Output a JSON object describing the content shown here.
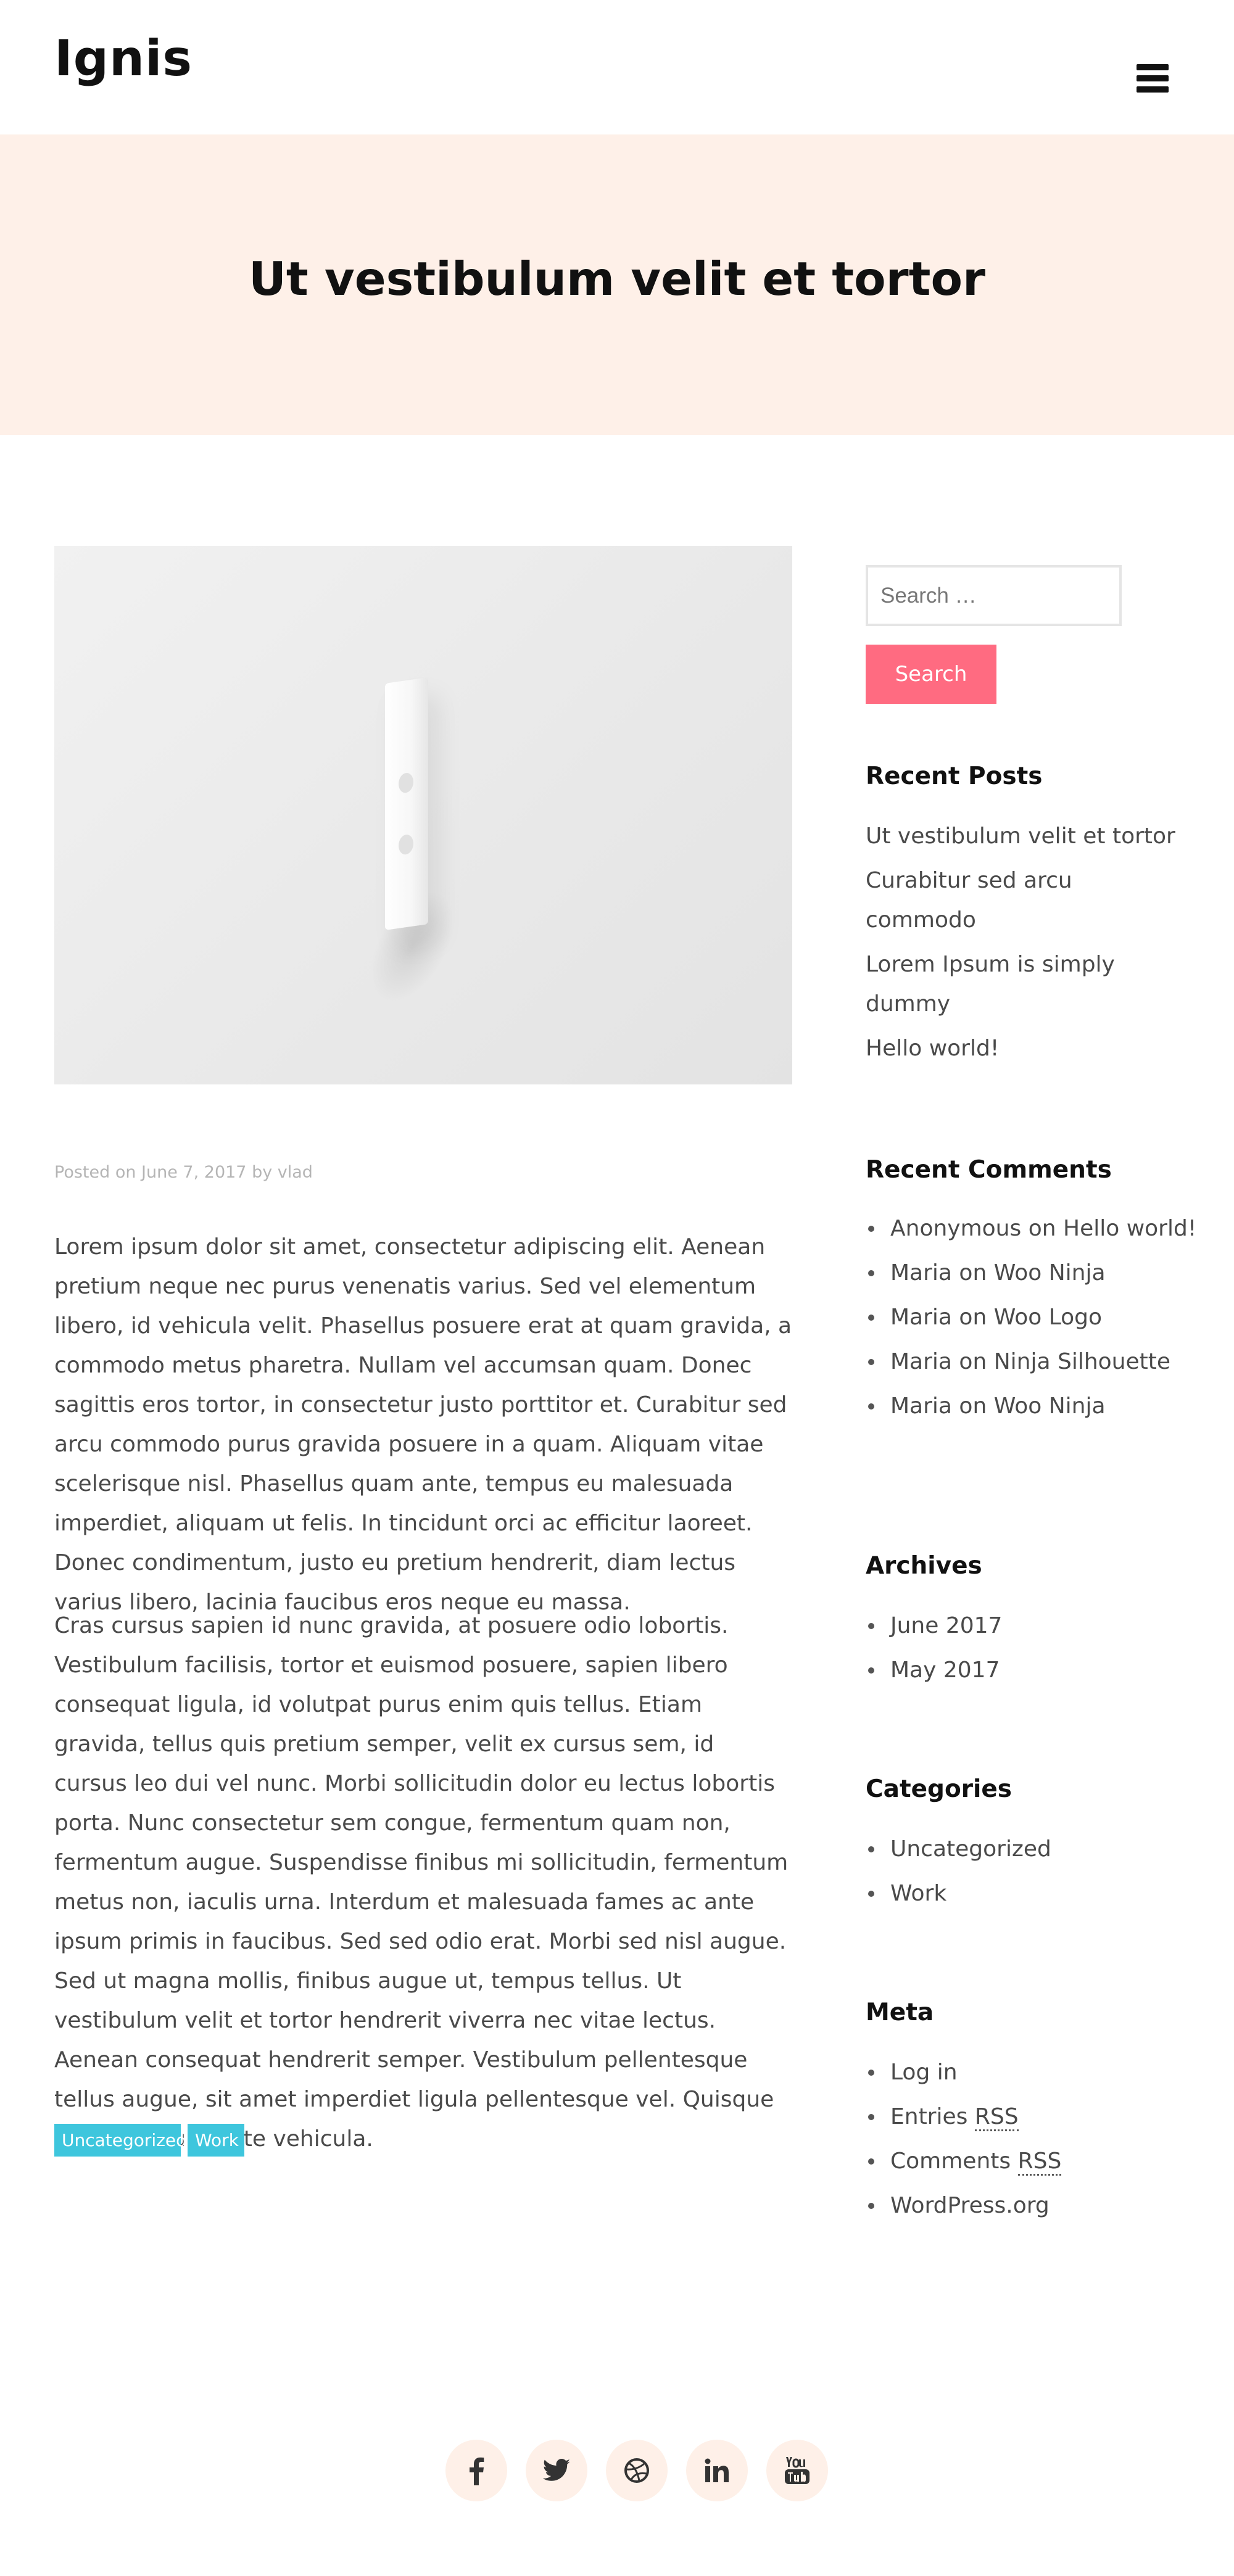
{
  "header": {
    "site_title": "Ignis",
    "menu_icon": "hamburger-menu-icon"
  },
  "hero": {
    "title": "Ut vestibulum velit et tortor"
  },
  "post": {
    "meta_prefix": "Posted on ",
    "date": "June 7, 2017",
    "meta_by": " by ",
    "author": "vlad",
    "paragraphs": [
      "Lorem ipsum dolor sit amet, consectetur adipiscing elit. Aenean pretium neque nec purus venenatis varius. Sed vel elementum libero, id vehicula velit. Phasellus posuere erat at quam gravida, a commodo metus pharetra. Nullam vel accumsan quam. Donec sagittis eros tortor, in consectetur justo porttitor et. Curabitur sed arcu commodo purus gravida posuere in a quam. Aliquam vitae scelerisque nisl. Phasellus quam ante, tempus eu malesuada imperdiet, aliquam ut felis. In tincidunt orci ac efficitur laoreet. Donec condimentum, justo eu pretium hendrerit, diam lectus varius libero, lacinia faucibus eros neque eu massa.",
      "Cras cursus sapien id nunc gravida, at posuere odio lobortis. Vestibulum facilisis, tortor et euismod posuere, sapien libero consequat ligula, id volutpat purus enim quis tellus. Etiam gravida, tellus quis pretium semper, velit ex cursus sem, id cursus leo dui vel nunc. Morbi sollicitudin dolor eu lectus lobortis porta. Nunc consectetur sem congue, fermentum quam non, fermentum augue. Suspendisse finibus mi sollicitudin, fermentum metus non, iaculis urna. Interdum et malesuada fames ac ante ipsum primis in faucibus. Sed sed odio erat. Morbi sed nisl augue. Sed ut magna mollis, finibus augue ut, tempus tellus. Ut vestibulum velit et tortor hendrerit viverra nec vitae lectus. Aenean consequat hendrerit semper. Vestibulum pellentesque tellus augue, sit amet imperdiet ligula pellentesque vel. Quisque tincidunt vulputate vehicula."
    ],
    "tags": [
      "Uncategorized",
      "Work"
    ]
  },
  "sidebar": {
    "search": {
      "placeholder": "Search …",
      "button_label": "Search"
    },
    "recent_posts": {
      "title": "Recent Posts",
      "items": [
        "Ut vestibulum velit et tortor",
        "Curabitur sed arcu commodo",
        "Lorem Ipsum is simply dummy",
        "Hello world!"
      ]
    },
    "recent_comments": {
      "title": "Recent Comments",
      "items": [
        {
          "author": "Anonymous",
          "on": " on ",
          "post": "Hello world!"
        },
        {
          "author": "Maria",
          "on": " on ",
          "post": "Woo Ninja"
        },
        {
          "author": "Maria",
          "on": " on ",
          "post": "Woo Logo"
        },
        {
          "author": "Maria",
          "on": " on ",
          "post": "Ninja Silhouette"
        },
        {
          "author": "Maria",
          "on": " on ",
          "post": "Woo Ninja"
        }
      ]
    },
    "archives": {
      "title": "Archives",
      "items": [
        "June 2017",
        "May 2017"
      ]
    },
    "categories": {
      "title": "Categories",
      "items": [
        "Uncategorized",
        "Work"
      ]
    },
    "meta": {
      "title": "Meta",
      "items": [
        {
          "text": "Log in",
          "abbr": ""
        },
        {
          "text": "Entries ",
          "abbr": "RSS"
        },
        {
          "text": "Comments ",
          "abbr": "RSS"
        },
        {
          "text": "WordPress.org",
          "abbr": ""
        }
      ]
    }
  },
  "footer": {
    "social": [
      "facebook-icon",
      "twitter-icon",
      "dribbble-icon",
      "linkedin-icon",
      "youtube-icon"
    ]
  },
  "colors": {
    "hero_bg": "#fef0e8",
    "accent_pink": "#ff6b81",
    "tag_cyan": "#3ec6dd",
    "text": "#4a4a4a",
    "heading": "#111111"
  }
}
